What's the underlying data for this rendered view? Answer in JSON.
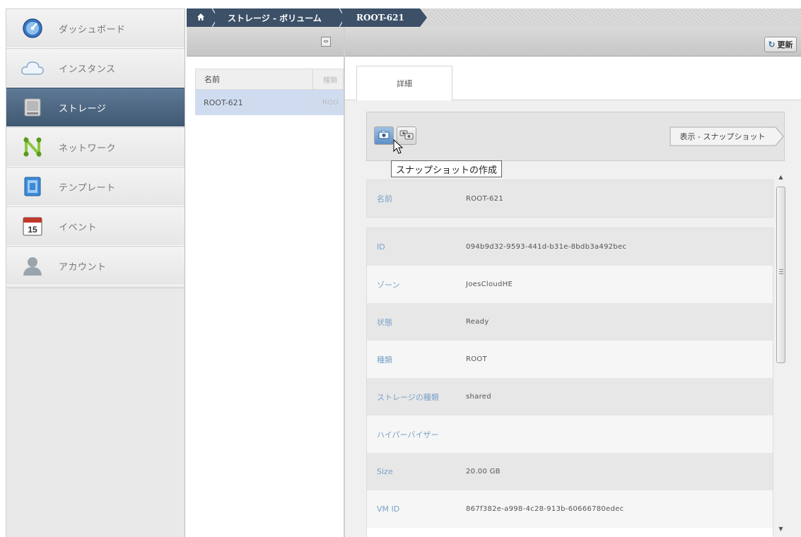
{
  "sidebar": {
    "items": [
      {
        "label": "ダッシュボード",
        "icon": "dashboard-icon"
      },
      {
        "label": "インスタンス",
        "icon": "cloud-icon"
      },
      {
        "label": "ストレージ",
        "icon": "storage-icon"
      },
      {
        "label": "ネットワーク",
        "icon": "network-icon"
      },
      {
        "label": "テンプレート",
        "icon": "template-icon"
      },
      {
        "label": "イベント",
        "icon": "calendar-icon",
        "day": "15"
      },
      {
        "label": "アカウント",
        "icon": "user-icon"
      }
    ],
    "active_index": 2
  },
  "breadcrumb": {
    "home_icon": "home-icon",
    "section": "ストレージ - ボリューム",
    "current": "ROOT-621"
  },
  "list": {
    "columns": [
      "名前",
      "種類"
    ],
    "rows": [
      {
        "name": "ROOT-621",
        "type": "ROO"
      }
    ]
  },
  "detail": {
    "refresh_label": "更新",
    "tab_label": "詳細",
    "view_snapshots_label": "表示 - スナップショット",
    "tooltip": "スナップショットの作成",
    "name_field": {
      "label": "名前",
      "value": "ROOT-621"
    },
    "fields": [
      {
        "label": "ID",
        "value": "094b9d32-9593-441d-b31e-8bdb3a492bec"
      },
      {
        "label": "ゾーン",
        "value": "JoesCloudHE"
      },
      {
        "label": "状態",
        "value": "Ready"
      },
      {
        "label": "種類",
        "value": "ROOT"
      },
      {
        "label": "ストレージの種類",
        "value": "shared"
      },
      {
        "label": "ハイパーバイザー",
        "value": ""
      },
      {
        "label": "Size",
        "value": "20.00 GB"
      },
      {
        "label": "VM ID",
        "value": "867f382e-a998-4c28-913b-60666780edec"
      }
    ]
  },
  "colors": {
    "accent": "#3c5068",
    "active_nav": "#4a6480",
    "field_label": "#7aa0c8",
    "selected_row": "#cfdcf0"
  }
}
